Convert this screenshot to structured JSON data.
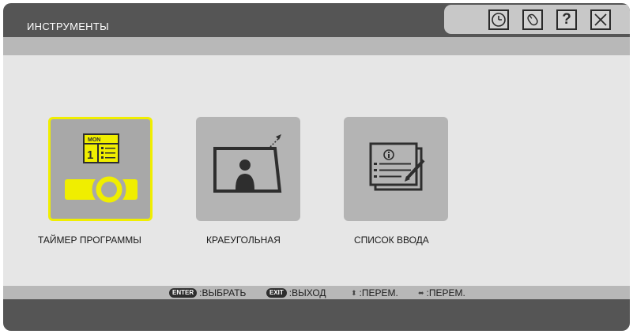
{
  "window": {
    "title": "ИНСТРУМЕНТЫ"
  },
  "toolbar": {
    "buttons": [
      {
        "name": "clock-icon"
      },
      {
        "name": "mouse-icon"
      },
      {
        "name": "help-icon",
        "glyph": "?"
      },
      {
        "name": "close-icon"
      }
    ]
  },
  "tiles": [
    {
      "label": "ТАЙМЕР ПРОГРАММЫ",
      "icon": "program-timer-icon",
      "calendar_day": "MON",
      "calendar_date": "1",
      "selected": true
    },
    {
      "label": "КРАЕУГОЛЬНАЯ",
      "icon": "cornerstone-icon",
      "selected": false
    },
    {
      "label": "СПИСОК ВВОДА",
      "icon": "input-list-icon",
      "selected": false
    }
  ],
  "help": {
    "enter_key": "ENTER",
    "enter_text": ":ВЫБРАТЬ",
    "exit_key": "EXIT",
    "exit_text": ":ВЫХОД",
    "updown_text": ":ПЕРЕМ.",
    "leftright_text": ":ПЕРЕМ."
  },
  "colors": {
    "selection": "#f0ee00",
    "title_bar": "#555555"
  }
}
